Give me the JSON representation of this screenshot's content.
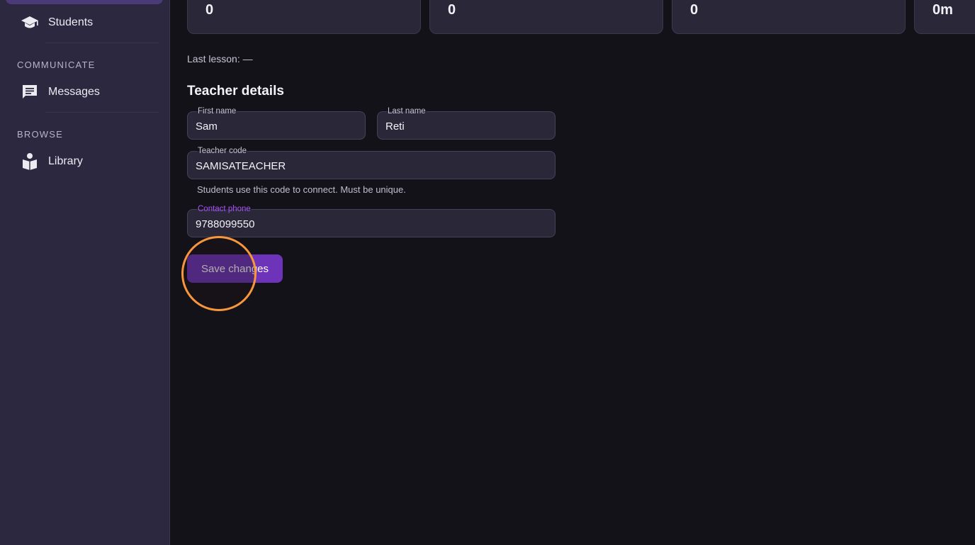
{
  "sidebar": {
    "items": [
      {
        "label": "Students",
        "icon": "graduation-cap-icon"
      }
    ],
    "sections": [
      {
        "title": "COMMUNICATE",
        "items": [
          {
            "label": "Messages",
            "icon": "chat-icon"
          }
        ]
      },
      {
        "title": "BROWSE",
        "items": [
          {
            "label": "Library",
            "icon": "reader-icon"
          }
        ]
      }
    ]
  },
  "stats": [
    {
      "value": "0"
    },
    {
      "value": "0"
    },
    {
      "value": "0"
    },
    {
      "value": "0m"
    }
  ],
  "last_lesson": "Last lesson: —",
  "teacher_details": {
    "heading": "Teacher details",
    "first_name": {
      "label": "First name",
      "value": "Sam"
    },
    "last_name": {
      "label": "Last name",
      "value": "Reti"
    },
    "teacher_code": {
      "label": "Teacher code",
      "value": "SAMISATEACHER",
      "helper": "Students use this code to connect. Must be unique."
    },
    "contact_phone": {
      "label": "Contact phone",
      "value": "9788099550"
    },
    "save_label": "Save changes"
  },
  "colors": {
    "accent": "#6d33b8",
    "focus_label": "#a855f7",
    "click_indicator": "#f7963b"
  }
}
